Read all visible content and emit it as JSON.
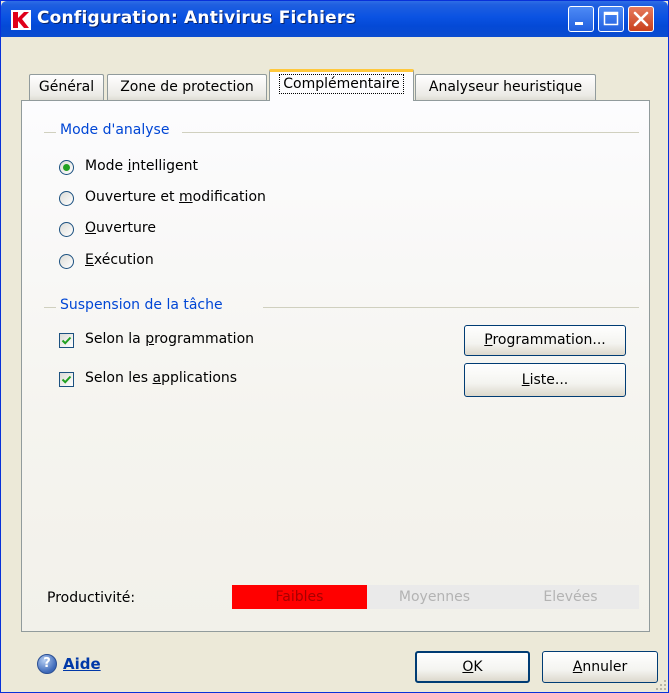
{
  "window": {
    "title": "Configuration: Antivirus Fichiers"
  },
  "tabs": [
    {
      "label": "Général"
    },
    {
      "label": "Zone de protection"
    },
    {
      "label": "Complémentaire",
      "active": true
    },
    {
      "label": "Analyseur heuristique"
    }
  ],
  "scan_mode": {
    "title": "Mode d'analyse",
    "options": [
      {
        "label": "Mode intelligent",
        "checked": true
      },
      {
        "label": "Ouverture et modification",
        "checked": false
      },
      {
        "label": "Ouverture",
        "checked": false
      },
      {
        "label": "Exécution",
        "checked": false
      }
    ]
  },
  "suspend": {
    "title": "Suspension de la tâche",
    "by_schedule": {
      "label": "Selon la programmation",
      "checked": true,
      "button": "Programmation..."
    },
    "by_apps": {
      "label": "Selon les applications",
      "checked": true,
      "button": "Liste..."
    }
  },
  "productivity": {
    "label": "Productivité:",
    "levels": [
      "Faibles",
      "Moyennes",
      "Elevées"
    ],
    "selected": "Faibles",
    "colors": {
      "selected": "#ff0000",
      "inactive": "#eaeaea"
    }
  },
  "footer": {
    "help": "Aide",
    "ok": "OK",
    "cancel": "Annuler"
  },
  "colors": {
    "titlebar": "#0a52e2",
    "group_title": "#0046d5",
    "tab_highlight": "#ffc83c"
  }
}
